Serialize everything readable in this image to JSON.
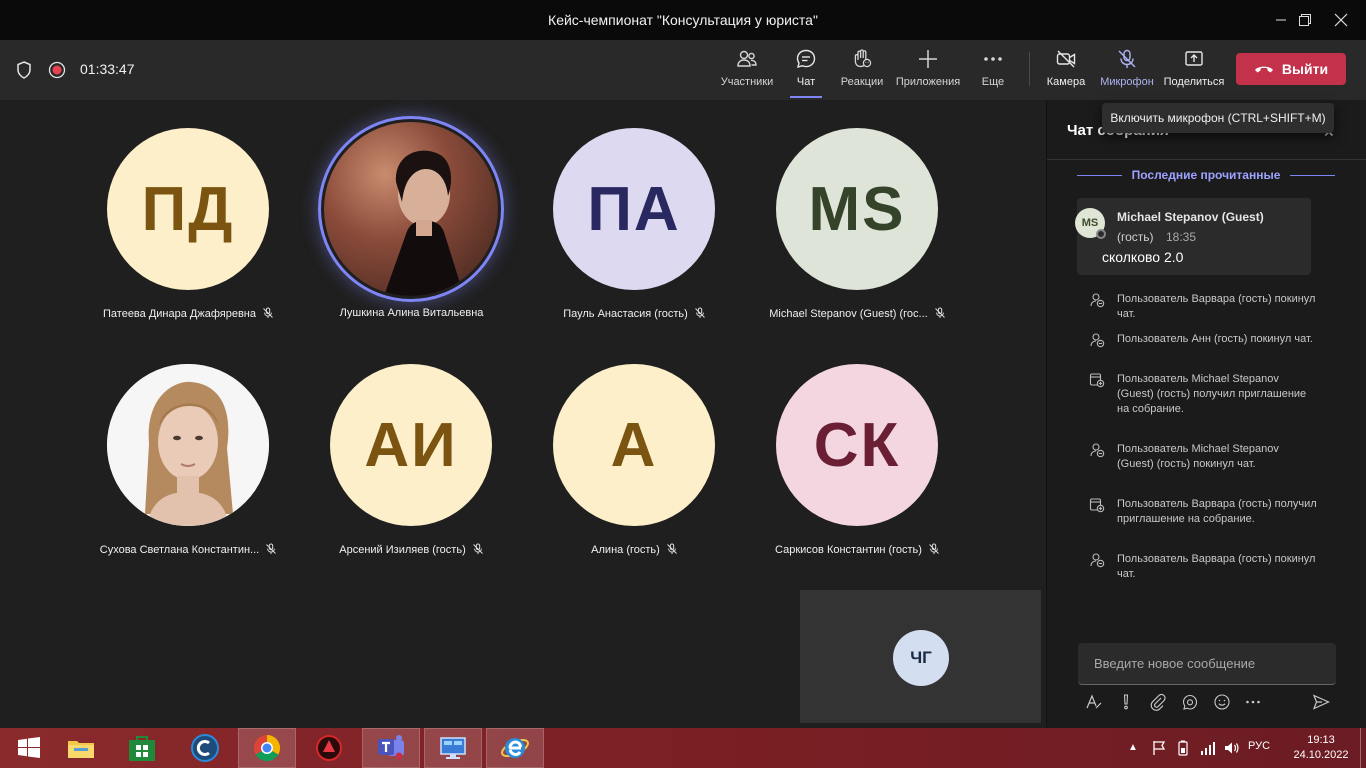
{
  "window": {
    "title": "Кейс-чемпионат \"Консультация у юриста\""
  },
  "meeting": {
    "timer": "01:33:47"
  },
  "toolbar": {
    "participants": "Участники",
    "chat": "Чат",
    "reactions": "Реакции",
    "apps": "Приложения",
    "more": "Еще",
    "camera": "Камера",
    "mic": "Микрофон",
    "share": "Поделиться",
    "leave": "Выйти"
  },
  "tooltip": "Включить микрофон (CTRL+SHIFT+M)",
  "participants": [
    {
      "initials": "ПД",
      "name": "Патеева Динара Джафяревна",
      "bg": "#fcefc9",
      "fg": "#7a5410",
      "photo": false,
      "muted": true
    },
    {
      "initials": "",
      "name": "Лушкина Алина Витальевна",
      "bg": "#4a2a24",
      "fg": "#ffffff",
      "photo": true,
      "muted": false,
      "speaking": true
    },
    {
      "initials": "ПА",
      "name": "Пауль Анастасия (гость)",
      "bg": "#dcd9f0",
      "fg": "#2a2860",
      "photo": false,
      "muted": true
    },
    {
      "initials": "MS",
      "name": "Michael Stepanov (Guest) (гос...",
      "bg": "#dee5d8",
      "fg": "#34432a",
      "photo": false,
      "muted": true
    },
    {
      "initials": "",
      "name": "Сухова Светлана Константин...",
      "bg": "#ffffff",
      "fg": "#333333",
      "photo": true,
      "muted": true
    },
    {
      "initials": "АИ",
      "name": "Арсений Изиляев (гость)",
      "bg": "#fcefc9",
      "fg": "#7a5410",
      "photo": false,
      "muted": true
    },
    {
      "initials": "А",
      "name": "Алина (гость)",
      "bg": "#fcefc9",
      "fg": "#7a5410",
      "photo": false,
      "muted": true
    },
    {
      "initials": "СК",
      "name": "Саркисов Константин (гость)",
      "bg": "#f4d6e0",
      "fg": "#6b1f35",
      "photo": false,
      "muted": true
    }
  ],
  "self": {
    "initials": "ЧГ"
  },
  "chat": {
    "title": "Чат собрания",
    "last_read": "Последние прочитанные",
    "message": {
      "avatar": "MS",
      "author": "Michael Stepanov (Guest)",
      "author_suffix": "(гость)",
      "time": "18:35",
      "text": "сколково 2.0"
    },
    "system": [
      {
        "icon": "person-left-icon",
        "text": "Пользователь Варвара (гость) покинул чат."
      },
      {
        "icon": "person-left-icon",
        "text": "Пользователь Анн (гость) покинул чат."
      },
      {
        "icon": "invite-icon",
        "text": "Пользователь Michael Stepanov (Guest) (гость) получил приглашение на собрание."
      },
      {
        "icon": "person-left-icon",
        "text": "Пользователь Michael Stepanov (Guest) (гость) покинул чат."
      },
      {
        "icon": "invite-icon",
        "text": "Пользователь Варвара (гость) получил приглашение на собрание."
      },
      {
        "icon": "person-left-icon",
        "text": "Пользователь Варвара (гость) покинул чат."
      }
    ],
    "compose_placeholder": "Введите новое сообщение"
  },
  "taskbar": {
    "lang": "РУС",
    "time": "19:13",
    "date": "24.10.2022"
  },
  "colors": {
    "accent": "#7f85f5",
    "leave": "#c4314b"
  }
}
